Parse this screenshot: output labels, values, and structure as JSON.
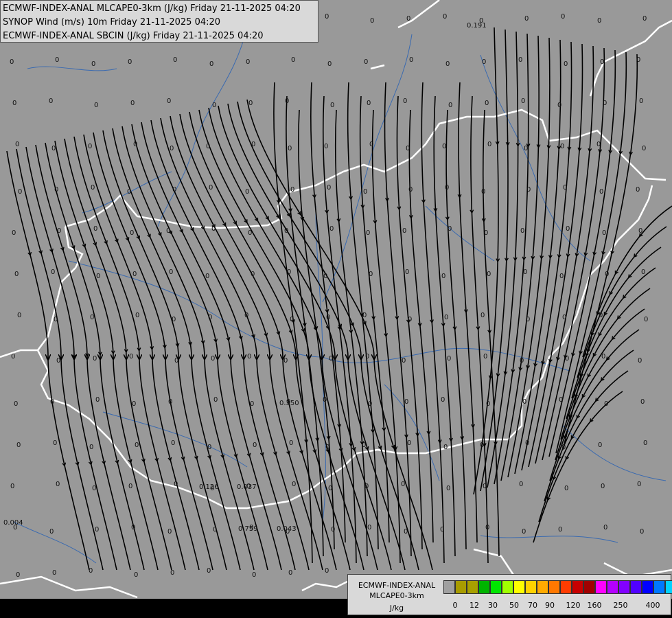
{
  "header": {
    "line1": "ECMWF-INDEX-ANAL MLCAPE0-3km (J/kg) Friday 21-11-2025 04:20",
    "line2": "SYNOP Wind (m/s) 10m Friday 21-11-2025 04:20",
    "line3": "ECMWF-INDEX-ANAL SBCIN (J/kg) Friday 21-11-2025 04:20"
  },
  "legend": {
    "title_line1": "ECMWF-INDEX-ANAL",
    "title_line2": "MLCAPE0-3km",
    "units": "J/kg",
    "colors": [
      "#a0a0a0",
      "#a89c00",
      "#a8a000",
      "#00b400",
      "#00e600",
      "#a0ff00",
      "#ffff00",
      "#ffd200",
      "#ffaa00",
      "#ff7800",
      "#ff3c00",
      "#c80000",
      "#a00000",
      "#ff00ff",
      "#b400ff",
      "#8200ff",
      "#5000ff",
      "#0000ff",
      "#0078ff",
      "#00d2ff",
      "#60ffff",
      "#ffffff"
    ],
    "ticks": [
      "0",
      "12",
      "30",
      "50",
      "70",
      "90",
      "120",
      "160",
      "250",
      "400"
    ]
  },
  "map": {
    "background": "#999999",
    "border_color": "#ffffff",
    "river_color": "#3a6ab0",
    "streamline_color": "#000000",
    "station_values": [
      {
        "v": "0"
      },
      {
        "v": "0.191"
      },
      {
        "v": "0.350"
      },
      {
        "v": "0.126"
      },
      {
        "v": "0.037"
      },
      {
        "v": "0.759"
      },
      {
        "v": "0.043"
      },
      {
        "v": "0.004"
      }
    ]
  }
}
